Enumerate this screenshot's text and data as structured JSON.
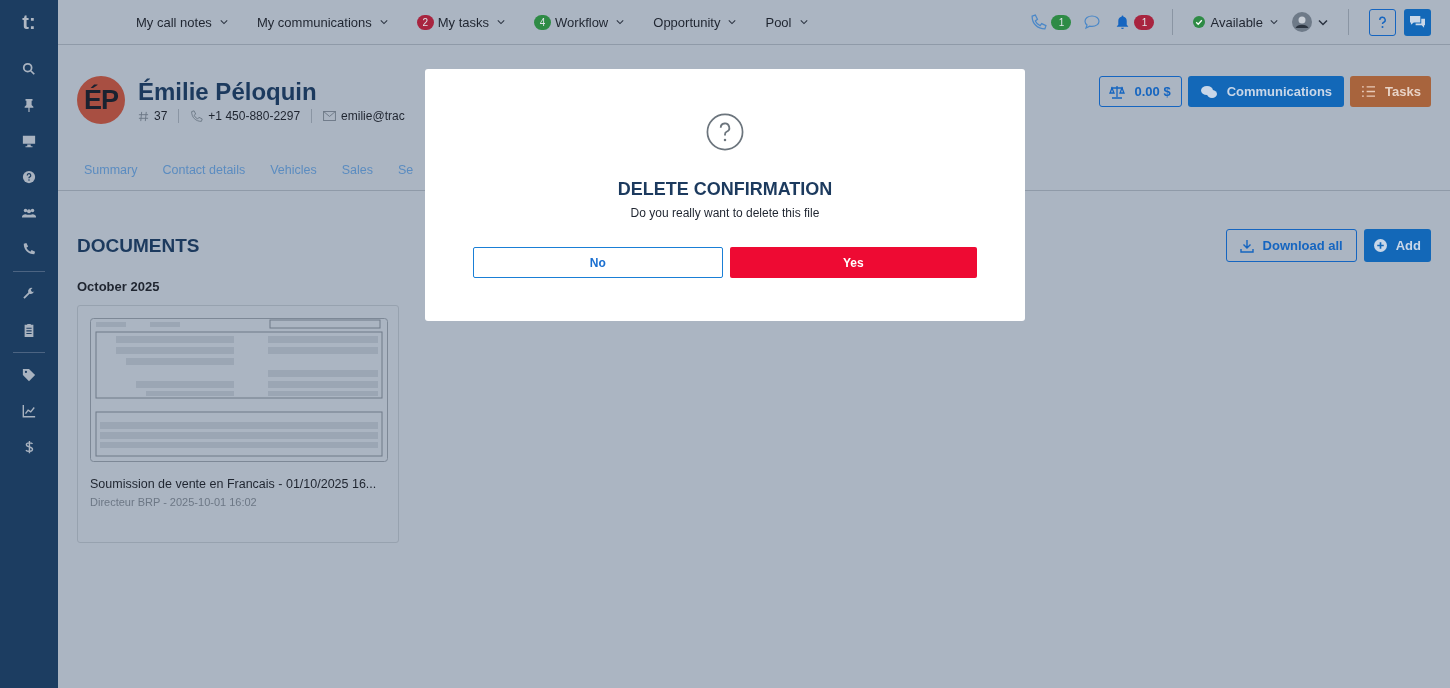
{
  "sidebar": {
    "logo": "t:"
  },
  "top_nav": {
    "menus": [
      {
        "label": "My call notes"
      },
      {
        "label": "My communications"
      },
      {
        "label": "My tasks",
        "badge": "2",
        "color": "#a8243f"
      },
      {
        "label": "Workflow",
        "badge": "4",
        "color": "#2e8b45"
      },
      {
        "label": "Opportunity"
      },
      {
        "label": "Pool"
      }
    ],
    "indicators": [
      {
        "kind": "phone",
        "badge": "1",
        "color": "#2e8b45"
      },
      {
        "kind": "chat"
      },
      {
        "kind": "bell",
        "badge": "1",
        "color": "#a8243f"
      }
    ],
    "status": {
      "label": "Available",
      "color": "#2e8b45"
    }
  },
  "contact": {
    "initials": "ÉP",
    "name": "Émilie Péloquin",
    "number": "37",
    "phone": "+1 450-880-2297",
    "email": "emilie@trac"
  },
  "header_buttons": [
    {
      "kind": "balance",
      "label": "0.00 $"
    },
    {
      "kind": "communications",
      "label": "Communications"
    },
    {
      "kind": "tasks",
      "label": "Tasks"
    }
  ],
  "tabs": [
    {
      "label": "Summary",
      "selected": false
    },
    {
      "label": "Contact details",
      "selected": false
    },
    {
      "label": "Vehicles",
      "selected": false
    },
    {
      "label": "Sales",
      "selected": false
    },
    {
      "label": "Se",
      "selected": false
    }
  ],
  "section": {
    "title": "DOCUMENTS",
    "actions": [
      {
        "kind": "download",
        "label": "Download all"
      },
      {
        "kind": "add",
        "label": "Add"
      }
    ]
  },
  "groups": [
    {
      "title": "October 2025",
      "documents": [
        {
          "title": "Soumission de vente en Francais - 01/10/2025 16...",
          "meta": "Directeur BRP - 2025-10-01 16:02"
        }
      ]
    }
  ],
  "modal": {
    "title": "DELETE CONFIRMATION",
    "message": "Do you really want to delete this file",
    "buttons": [
      {
        "kind": "cancel",
        "label": "No"
      },
      {
        "kind": "confirm",
        "label": "Yes"
      }
    ]
  }
}
